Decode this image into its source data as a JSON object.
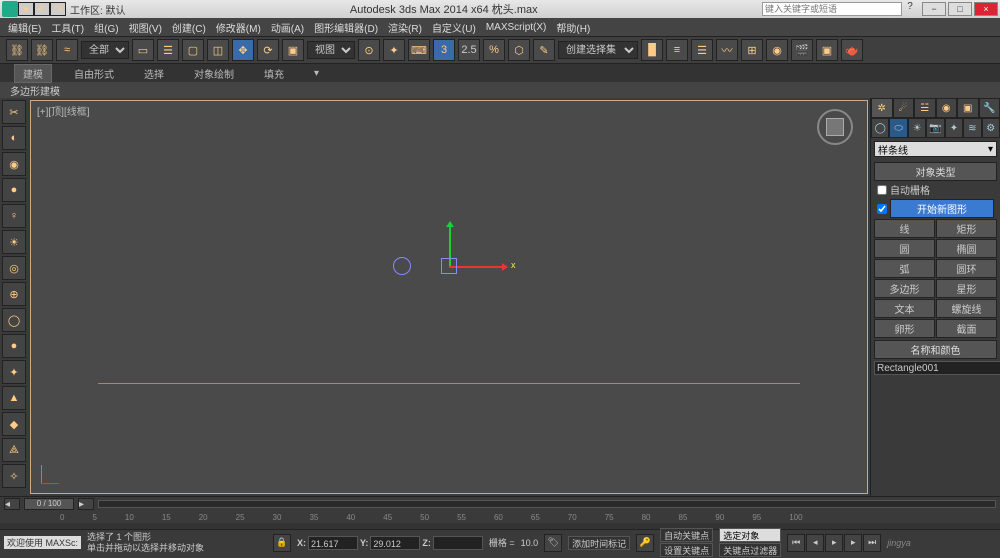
{
  "titlebar": {
    "workspace_label": "工作区: 默认",
    "app_title": "Autodesk 3ds Max 2014 x64   枕头.max",
    "search_placeholder": "键入关键字或短语"
  },
  "winbtns": {
    "min": "−",
    "max": "□",
    "close": "×"
  },
  "menu": {
    "items": [
      "编辑(E)",
      "工具(T)",
      "组(G)",
      "视图(V)",
      "创建(C)",
      "修改器(M)",
      "动画(A)",
      "图形编辑器(D)",
      "渲染(R)",
      "自定义(U)",
      "MAXScript(X)",
      "帮助(H)"
    ]
  },
  "maintool": {
    "all_dropdown": "全部",
    "view_dropdown": "视图",
    "selset_dropdown": "创建选择集"
  },
  "ribbon": {
    "tabs": [
      "建模",
      "自由形式",
      "选择",
      "对象绘制",
      "填充"
    ]
  },
  "subribbon": {
    "label": "多边形建模"
  },
  "viewport": {
    "label": "[+][顶][线框]",
    "x_axis": "x"
  },
  "cmdpanel": {
    "category_dropdown": "样条线",
    "rollout_objtype": "对象类型",
    "autogrid": "自动栅格",
    "start_new": "开始新图形",
    "buttons": {
      "line": "线",
      "rect": "矩形",
      "circle": "圆",
      "ellipse": "椭圆",
      "arc": "弧",
      "donut": "圆环",
      "ngon": "多边形",
      "star": "星形",
      "text": "文本",
      "helix": "螺旋线",
      "egg": "卵形",
      "section": "截面"
    },
    "rollout_name": "名称和颜色",
    "obj_name": "Rectangle001"
  },
  "timeline": {
    "slider": "0 / 100",
    "ticks": [
      "0",
      "5",
      "10",
      "15",
      "20",
      "25",
      "30",
      "35",
      "40",
      "45",
      "50",
      "55",
      "60",
      "65",
      "70",
      "75",
      "80",
      "85",
      "90",
      "95",
      "100"
    ]
  },
  "status": {
    "welcome": "欢迎使用 MAXSc:",
    "line1": "选择了 1 个图形",
    "line2": "单击并拖动以选择并移动对象",
    "x_lbl": "X:",
    "x": "21.617",
    "y_lbl": "Y:",
    "y": "29.012",
    "z_lbl": "Z:",
    "grid_lbl": "栅格 =",
    "grid": "10.0",
    "autokey": "自动关键点",
    "selfilter": "选定对象",
    "setkey": "设置关键点",
    "keyfilter": "关键点过滤器",
    "addtime": "添加时间标记",
    "watermark": "jingya"
  }
}
